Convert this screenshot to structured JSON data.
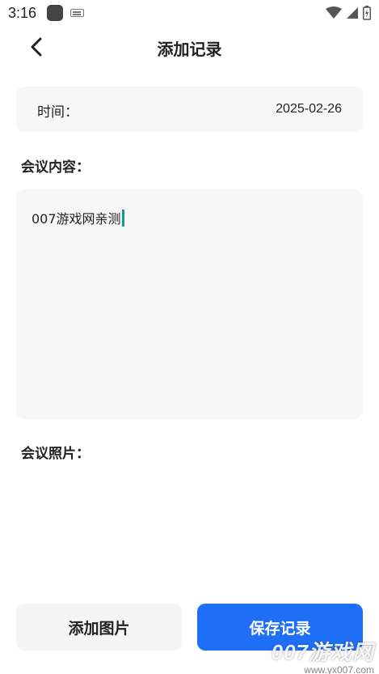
{
  "status_bar": {
    "time": "3:16",
    "icons": [
      "app-icon",
      "keyboard-icon",
      "wifi-icon",
      "signal-icon",
      "battery-icon"
    ]
  },
  "header": {
    "title": "添加记录",
    "back_icon": "chevron-left-icon"
  },
  "time_field": {
    "label": "时间：",
    "value": "2025-02-26"
  },
  "content_field": {
    "label": "会议内容：",
    "value": "007游戏网亲测"
  },
  "photo_field": {
    "label": "会议照片："
  },
  "buttons": {
    "add_photo": "添加图片",
    "save": "保存记录"
  },
  "watermark": {
    "brand": "007游戏网",
    "url": "www.yx007.com"
  },
  "colors": {
    "primary": "#1e6ff6",
    "card_bg": "#f7f7f7",
    "caret": "#0f9d8a"
  }
}
